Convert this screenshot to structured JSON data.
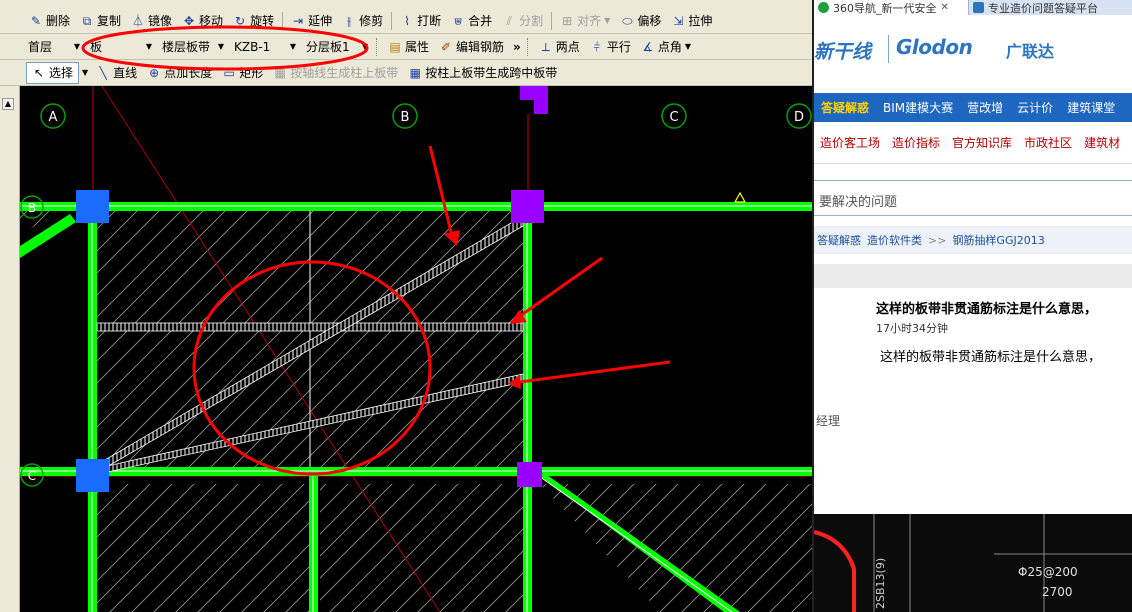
{
  "cad": {
    "toolbar1": {
      "delete": "删除",
      "copy": "复制",
      "mirror": "镜像",
      "move": "移动",
      "rotate": "旋转",
      "extend": "延伸",
      "trim": "修剪",
      "break": "打断",
      "merge": "合并",
      "split": "分割",
      "align": "对齐",
      "offset": "偏移",
      "stretch": "拉伸"
    },
    "toolbar2": {
      "floor": "首层",
      "category": "板",
      "component_type": "楼层板带",
      "component_name": "KZB-1",
      "layer": "分层板1",
      "properties": "属性",
      "edit_rebar": "编辑钢筋",
      "two_points": "两点",
      "parallel": "平行",
      "point_angle": "点角"
    },
    "toolbar3": {
      "select": "选择",
      "line": "直线",
      "point_add_length": "点加长度",
      "rectangle": "矩形",
      "gen_by_axis": "按轴线生成柱上板带",
      "gen_by_column": "按柱上板带生成跨中板带"
    },
    "axes": {
      "top": [
        "A",
        "B",
        "C",
        "D"
      ],
      "left": [
        "B",
        "C"
      ]
    },
    "colors": {
      "beam": "#00ff00",
      "column_blue": "#1a6cff",
      "column_purple": "#9900ff",
      "annotation": "#ff0000",
      "canvas": "#000000"
    }
  },
  "browser": {
    "tabs": [
      {
        "label": "360导航_新一代安全",
        "active": true
      },
      {
        "label": "专业造价问题答疑平台",
        "active": false
      }
    ],
    "logo": {
      "partial_text": "新干线",
      "brand": "Glodon",
      "brand_cn": "广联达"
    },
    "nav": [
      "答疑解惑",
      "BIM建模大赛",
      "营改增",
      "云计价",
      "建筑课堂"
    ],
    "subnav": [
      "造价客工场",
      "造价指标",
      "官方知识库",
      "市政社区",
      "建筑材"
    ],
    "search_placeholder": "要解决的问题",
    "breadcrumbs": [
      "答疑解惑",
      "造价软件类",
      "钢筋抽样GGJ2013"
    ],
    "question": {
      "title": "这样的板带非贯通筋标注是什么意思，",
      "time": "17小时34分钟",
      "body": "这样的板带非贯通筋标注是什么意思，"
    },
    "role_text": "经理",
    "preview": {
      "label1": "Φ25@200",
      "label2": "2700",
      "vertical_text": "2SB13(9)"
    }
  }
}
